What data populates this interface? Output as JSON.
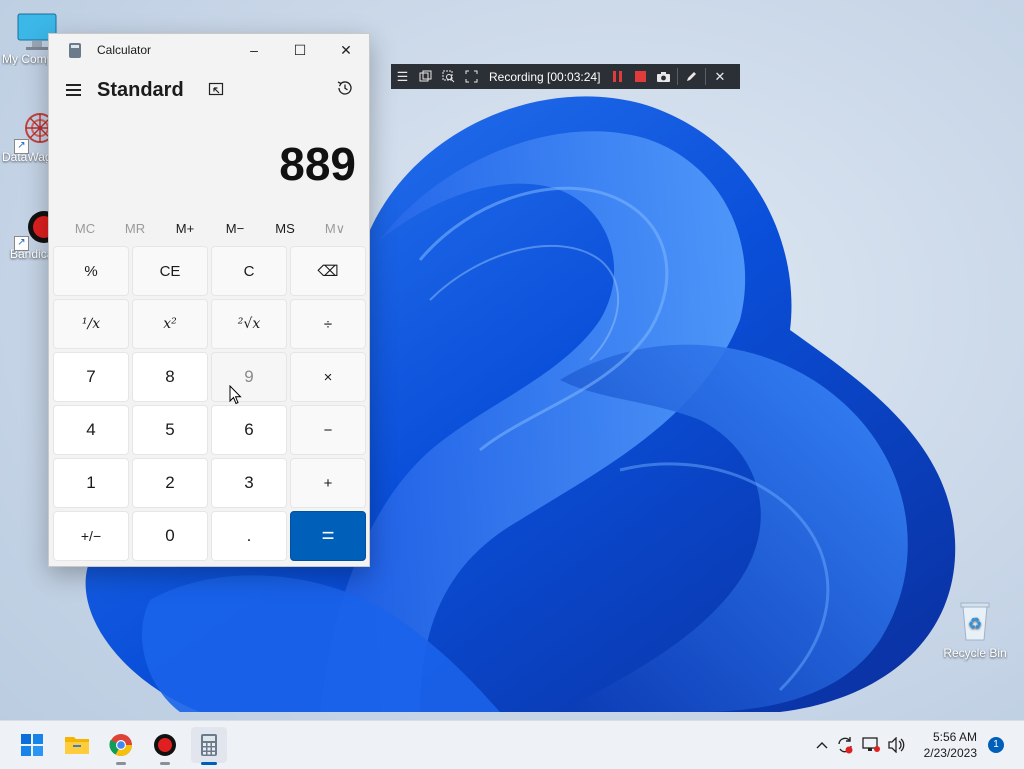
{
  "desktop": {
    "icons": [
      {
        "label": "My Computer",
        "icon": "monitor-icon"
      },
      {
        "label": "DataWag",
        "icon": "datawag-icon"
      },
      {
        "label": "Bandicam",
        "icon": "bandicam-icon"
      },
      {
        "label": "Recycle Bin",
        "icon": "recycle-bin-icon"
      }
    ]
  },
  "calculator": {
    "title": "Calculator",
    "window_buttons": {
      "minimize": "–",
      "maximize": "☐",
      "close": "✕"
    },
    "mode": "Standard",
    "display": "889",
    "memory": [
      "MC",
      "MR",
      "M+",
      "M−",
      "MS",
      "M∨"
    ],
    "keys": {
      "percent": "%",
      "ce": "CE",
      "clear": "C",
      "backspace": "⌫",
      "reciprocal": "¹∕x",
      "square": "x²",
      "sqrt": "²√x",
      "divide": "÷",
      "seven": "7",
      "eight": "8",
      "nine": "9",
      "multiply": "×",
      "four": "4",
      "five": "5",
      "six": "6",
      "minus": "−",
      "one": "1",
      "two": "2",
      "three": "3",
      "plus": "+",
      "negate": "+/−",
      "zero": "0",
      "decimal": ".",
      "equals": "="
    }
  },
  "recorder": {
    "text": "Recording [00:03:24]",
    "accent": "#e23b3b"
  },
  "taskbar": {
    "apps": [
      "start-icon",
      "file-explorer-icon",
      "chrome-icon",
      "bandicam-icon",
      "calculator-icon"
    ],
    "time": "5:56 AM",
    "date": "2/23/2023",
    "notification_count": "1"
  },
  "colors": {
    "accent": "#005fb8",
    "window_bg": "#f3f3f3",
    "toolbar_bg": "#2b2f36"
  }
}
